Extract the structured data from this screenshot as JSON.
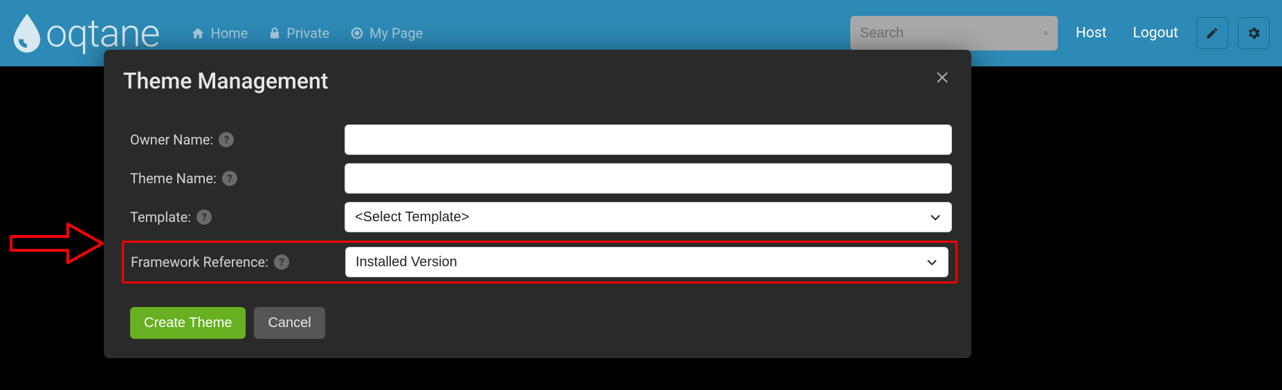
{
  "brand": {
    "name": "oqtane"
  },
  "nav": {
    "home": "Home",
    "private": "Private",
    "mypage": "My Page"
  },
  "search": {
    "placeholder": "Search"
  },
  "user": {
    "host": "Host",
    "logout": "Logout"
  },
  "modal": {
    "title": "Theme Management",
    "labels": {
      "owner": "Owner Name:",
      "theme": "Theme Name:",
      "template": "Template:",
      "framework": "Framework Reference:"
    },
    "values": {
      "owner": "",
      "theme": "",
      "template": "<Select Template>",
      "framework": "Installed Version"
    },
    "buttons": {
      "create": "Create Theme",
      "cancel": "Cancel"
    }
  }
}
